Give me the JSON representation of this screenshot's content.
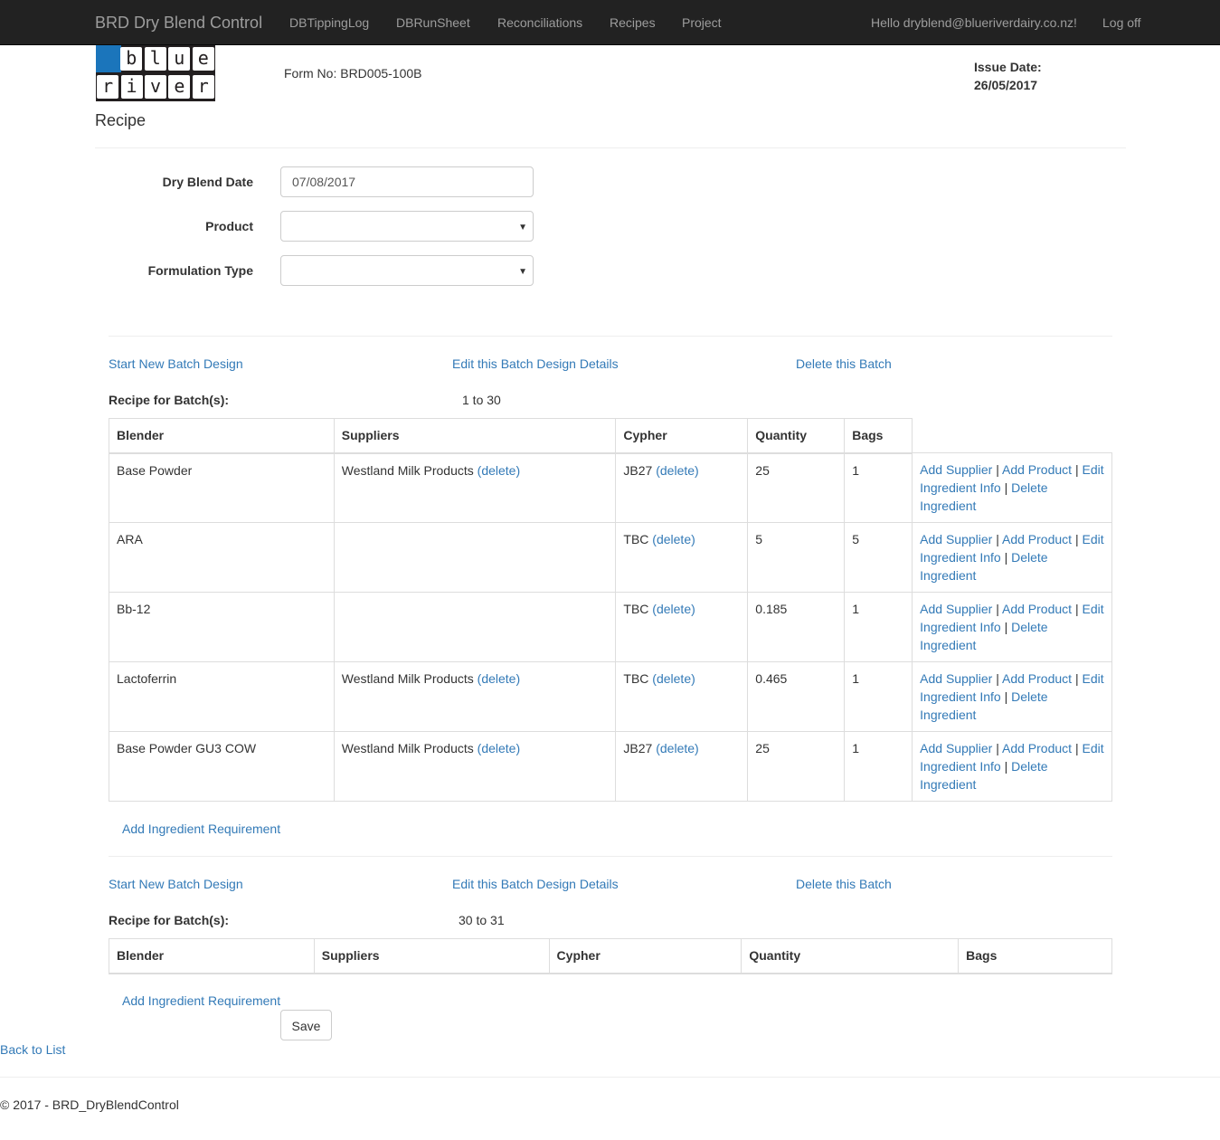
{
  "navbar": {
    "brand": "BRD Dry Blend Control",
    "items": [
      "DBTippingLog",
      "DBRunSheet",
      "Reconciliations",
      "Recipes",
      "Project"
    ],
    "greeting": "Hello dryblend@blueriverdairy.co.nz!",
    "logoff": "Log off"
  },
  "logo": {
    "row1": [
      "b",
      "l",
      "u",
      "e"
    ],
    "row2": [
      "r",
      "i",
      "v",
      "e",
      "r"
    ],
    "accent_color": "#1b75bb"
  },
  "header": {
    "form_no": "Form No: BRD005-100B",
    "issue_date_label": "Issue Date:",
    "issue_date_value": "26/05/2017",
    "page_title": "Recipe"
  },
  "form": {
    "dry_blend_date_label": "Dry Blend Date",
    "dry_blend_date_value": "07/08/2017",
    "product_label": "Product",
    "product_value": "",
    "formulation_type_label": "Formulation Type",
    "formulation_type_value": ""
  },
  "batch_actions": {
    "start_new": "Start New Batch Design",
    "edit_details": "Edit this Batch Design Details",
    "delete_batch": "Delete this Batch"
  },
  "batches": [
    {
      "label": "Recipe for Batch(s):",
      "range": "1 to 30",
      "columns": [
        "Blender",
        "Suppliers",
        "Cypher",
        "Quantity",
        "Bags"
      ],
      "rows": [
        {
          "blender": "Base Powder",
          "supplier": "Westland Milk Products",
          "cypher": "JB27",
          "quantity": "25",
          "bags": "1"
        },
        {
          "blender": "ARA",
          "supplier": "",
          "cypher": "TBC",
          "quantity": "5",
          "bags": "5"
        },
        {
          "blender": "Bb-12",
          "supplier": "",
          "cypher": "TBC",
          "quantity": "0.185",
          "bags": "1"
        },
        {
          "blender": "Lactoferrin",
          "supplier": "Westland Milk Products",
          "cypher": "TBC",
          "quantity": "0.465",
          "bags": "1"
        },
        {
          "blender": "Base Powder GU3 COW",
          "supplier": "Westland Milk Products",
          "cypher": "JB27",
          "quantity": "25",
          "bags": "1"
        }
      ]
    },
    {
      "label": "Recipe for Batch(s):",
      "range": "30 to 31",
      "columns": [
        "Blender",
        "Suppliers",
        "Cypher",
        "Quantity",
        "Bags"
      ],
      "rows": []
    }
  ],
  "row_actions": {
    "delete": "(delete)",
    "add_supplier": "Add Supplier",
    "add_product": "Add Product",
    "edit_ingredient_info": "Edit Ingredient Info",
    "delete_ingredient_1": "Delete",
    "delete_ingredient_2": "Ingredient",
    "separator": "|"
  },
  "add_ingredient_requirement": "Add Ingredient Requirement",
  "save_label": "Save",
  "back_to_list": "Back to List",
  "footer": "© 2017 - BRD_DryBlendControl"
}
